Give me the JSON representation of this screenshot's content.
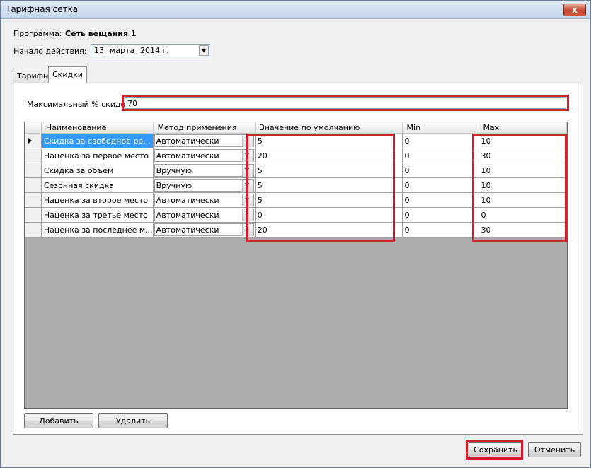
{
  "window": {
    "title": "Тарифная сетка",
    "close_glyph": "x"
  },
  "header": {
    "program_label": "Программа:",
    "program_value": "Сеть вещания 1",
    "start_label": "Начало действия:",
    "date": {
      "day": "13",
      "month": "марта",
      "year": "2014 г."
    }
  },
  "tabs": [
    {
      "label": "Тарифы"
    },
    {
      "label": "Скидки"
    }
  ],
  "discounts": {
    "max_label": "Максимальный % скидок:",
    "max_value": "70",
    "columns": [
      "Наименование",
      "Метод применения",
      "Значение по умолчанию",
      "Min",
      "Max"
    ],
    "rows": [
      {
        "name": "Скидка за свободное ра...",
        "method": "Автоматически",
        "default": "5",
        "min": "0",
        "max": "10"
      },
      {
        "name": "Наценка за первое место",
        "method": "Автоматически",
        "default": "20",
        "min": "0",
        "max": "30"
      },
      {
        "name": "Скидка за объем",
        "method": "Вручную",
        "default": "5",
        "min": "0",
        "max": "10"
      },
      {
        "name": "Сезонная скидка",
        "method": "Вручную",
        "default": "5",
        "min": "0",
        "max": "10"
      },
      {
        "name": "Наценка за второе место",
        "method": "Автоматически",
        "default": "5",
        "min": "0",
        "max": "10"
      },
      {
        "name": "Наценка за третье место",
        "method": "Автоматически",
        "default": "0",
        "min": "0",
        "max": "0"
      },
      {
        "name": "Наценка за последнее м...",
        "method": "Автоматически",
        "default": "20",
        "min": "0",
        "max": "30"
      }
    ],
    "add_label": "Добавить",
    "delete_label": "Удалить"
  },
  "footer": {
    "save_label": "Сохранить",
    "cancel_label": "Отменить"
  },
  "colors": {
    "highlight": "#d0202a",
    "selection": "#3399ff"
  }
}
